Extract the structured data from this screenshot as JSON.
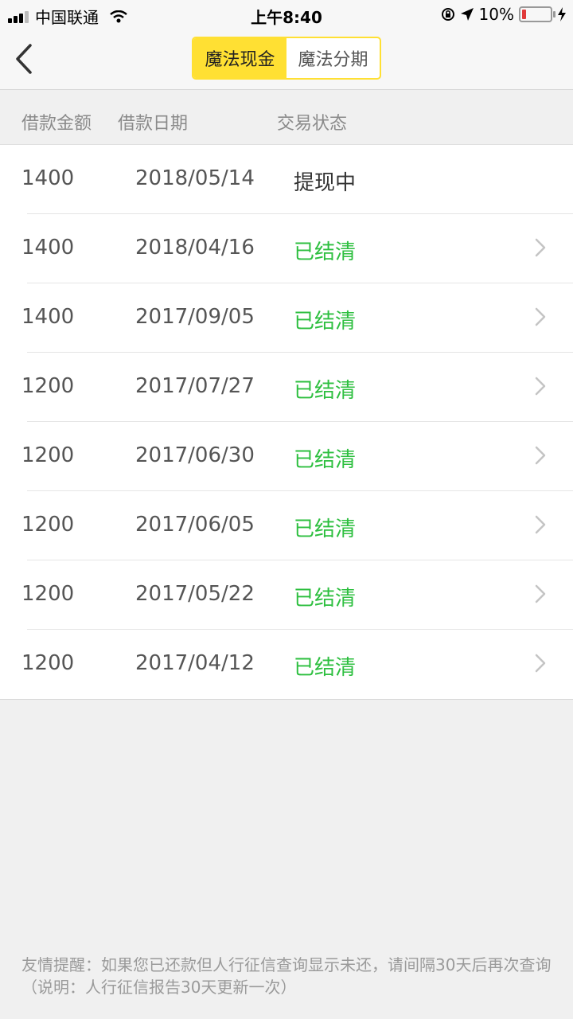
{
  "status_bar": {
    "carrier": "中国联通",
    "time": "上午8:40",
    "battery_percent": "10%"
  },
  "nav": {
    "tabs": [
      {
        "label": "魔法现金",
        "active": true
      },
      {
        "label": "魔法分期",
        "active": false
      }
    ]
  },
  "columns": {
    "amount": "借款金额",
    "date": "借款日期",
    "status": "交易状态"
  },
  "loans": [
    {
      "amount": "1400",
      "date": "2018/05/14",
      "status": "提现中",
      "state": "pending"
    },
    {
      "amount": "1400",
      "date": "2018/04/16",
      "status": "已结清",
      "state": "settled"
    },
    {
      "amount": "1400",
      "date": "2017/09/05",
      "status": "已结清",
      "state": "settled"
    },
    {
      "amount": "1200",
      "date": "2017/07/27",
      "status": "已结清",
      "state": "settled"
    },
    {
      "amount": "1200",
      "date": "2017/06/30",
      "status": "已结清",
      "state": "settled"
    },
    {
      "amount": "1200",
      "date": "2017/06/05",
      "status": "已结清",
      "state": "settled"
    },
    {
      "amount": "1200",
      "date": "2017/05/22",
      "status": "已结清",
      "state": "settled"
    },
    {
      "amount": "1200",
      "date": "2017/04/12",
      "status": "已结清",
      "state": "settled"
    }
  ],
  "footer": {
    "notice": "友情提醒：如果您已还款但人行征信查询显示未还，请间隔30天后再次查询（说明：人行征信报告30天更新一次）"
  },
  "colors": {
    "accent": "#ffe033",
    "settled": "#2dbf3f"
  }
}
